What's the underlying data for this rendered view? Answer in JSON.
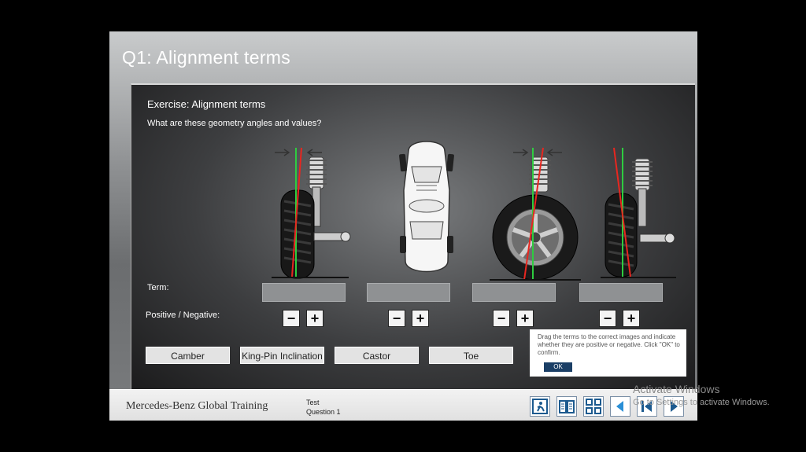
{
  "app": {
    "title": "Q1: Alignment terms"
  },
  "exercise": {
    "title": "Exercise: Alignment terms",
    "question": "What are these geometry angles and values?",
    "term_label": "Term:",
    "sign_label": "Positive / Negative:",
    "minus": "−",
    "plus": "+",
    "figures": [
      {
        "icon": "camber-wheel-icon"
      },
      {
        "icon": "car-top-view-toe-icon"
      },
      {
        "icon": "king-pin-inclination-wheel-icon"
      },
      {
        "icon": "castor-wheel-icon"
      }
    ],
    "terms": [
      "Camber",
      "King-Pin Inclination",
      "Castor",
      "Toe"
    ]
  },
  "help": {
    "text": "Drag the terms to the correct images and indicate whether they are positive or negative. Click \"OK\" to confirm.",
    "ok_label": "OK"
  },
  "footer": {
    "brand": "Mercedes-Benz Global Training",
    "test": "Test",
    "question": "Question 1",
    "buttons": [
      "exit-icon",
      "glossary-book-icon",
      "menu-grid-icon",
      "back-arrow-icon",
      "first-page-icon",
      "next-arrow-icon"
    ]
  },
  "watermark": {
    "line1": "Activate Windows",
    "line2": "Go to Settings to activate Windows."
  },
  "colors": {
    "green_line": "#2ecc40",
    "red_line": "#e8261f",
    "ok_button": "#1b3f66",
    "footer_icon": "#1c5a8f"
  }
}
